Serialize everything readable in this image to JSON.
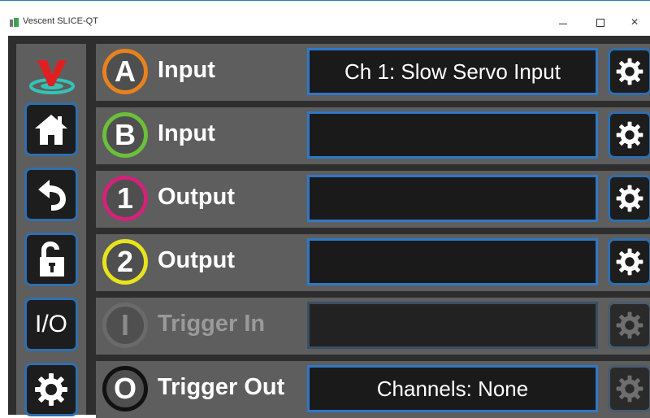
{
  "window": {
    "title": "Vescent SLICE-QT",
    "minimize_label": "",
    "maximize_label": "",
    "close_label": "×"
  },
  "sidebar": {
    "items": [
      {
        "name": "vescent-logo-icon"
      },
      {
        "name": "home-icon"
      },
      {
        "name": "back-icon"
      },
      {
        "name": "unlock-icon"
      },
      {
        "name": "io-button",
        "label": "I/O"
      },
      {
        "name": "settings-gear-icon"
      }
    ]
  },
  "rows": [
    {
      "badge": "A",
      "badge_color": "#e8821e",
      "label": "Input",
      "value": "Ch 1: Slow Servo Input",
      "enabled": true
    },
    {
      "badge": "B",
      "badge_color": "#6cbf3b",
      "label": "Input",
      "value": "",
      "enabled": true
    },
    {
      "badge": "1",
      "badge_color": "#d0237a",
      "label": "Output",
      "value": "",
      "enabled": true
    },
    {
      "badge": "2",
      "badge_color": "#e9e31e",
      "label": "Output",
      "value": "",
      "enabled": true
    },
    {
      "badge": "I",
      "badge_color": "#6a6a6a",
      "label": "Trigger In",
      "value": "",
      "enabled": false
    },
    {
      "badge": "O",
      "badge_color": "#111111",
      "label": "Trigger Out",
      "value": "Channels: None",
      "enabled": true
    }
  ],
  "colors": {
    "accent_blue": "#2f78c8",
    "panel_gray": "#5e5e5e",
    "background": "#2e2e2e"
  }
}
